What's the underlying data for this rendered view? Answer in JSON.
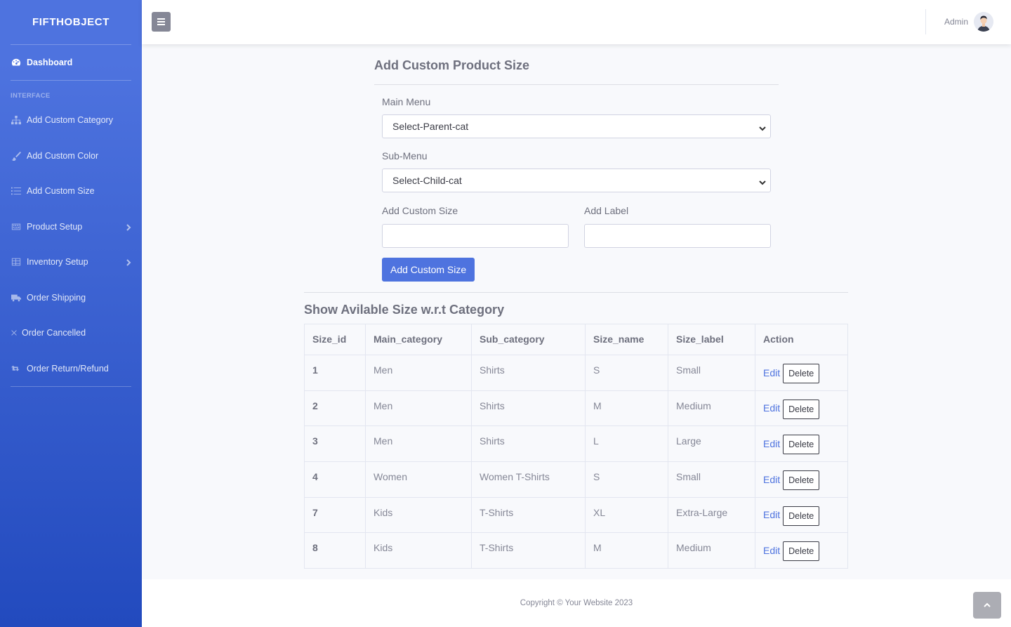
{
  "brand": "FIFTHOBJECT",
  "sidebar": {
    "dashboard": {
      "label": "Dashboard",
      "icon": "tachometer-icon"
    },
    "heading": "INTERFACE",
    "items": [
      {
        "label": "Add Custom Category",
        "icon": "sitemap-icon"
      },
      {
        "label": "Add Custom Color",
        "icon": "brush-icon"
      },
      {
        "label": "Add Custom Size",
        "icon": "list-icon"
      },
      {
        "label": "Product Setup",
        "icon": "keyboard-icon",
        "has_submenu": true
      },
      {
        "label": "Inventory Setup",
        "icon": "table-icon",
        "has_submenu": true
      },
      {
        "label": "Order Shipping",
        "icon": "truck-icon"
      },
      {
        "label": "Order Cancelled",
        "icon": "times-icon"
      },
      {
        "label": "Order Return/Refund",
        "icon": "retweet-icon"
      }
    ]
  },
  "topbar": {
    "user_name": "Admin"
  },
  "form": {
    "title": "Add Custom Product Size",
    "main_menu_label": "Main Menu",
    "main_menu_selected": "Select-Parent-cat",
    "sub_menu_label": "Sub-Menu",
    "sub_menu_selected": "Select-Child-cat",
    "custom_size_label": "Add Custom Size",
    "custom_size_value": "",
    "add_label_label": "Add Label",
    "add_label_value": "",
    "submit_label": "Add Custom Size"
  },
  "table": {
    "title": "Show Avilable Size w.r.t Category",
    "headers": [
      "Size_id",
      "Main_category",
      "Sub_category",
      "Size_name",
      "Size_label",
      "Action"
    ],
    "edit_label": "Edit",
    "delete_label": "Delete",
    "rows": [
      [
        "1",
        "Men",
        "Shirts",
        "S",
        "Small"
      ],
      [
        "2",
        "Men",
        "Shirts",
        "M",
        "Medium"
      ],
      [
        "3",
        "Men",
        "Shirts",
        "L",
        "Large"
      ],
      [
        "4",
        "Women",
        "Women T-Shirts",
        "S",
        "Small"
      ],
      [
        "7",
        "Kids",
        "T-Shirts",
        "XL",
        "Extra-Large"
      ],
      [
        "8",
        "Kids",
        "T-Shirts",
        "M",
        "Medium"
      ]
    ]
  },
  "footer": {
    "copyright": "Copyright © Your Website 2023"
  },
  "colors": {
    "sidebar_start": "#4e73df",
    "sidebar_end": "#224abe",
    "primary": "#4e73df"
  }
}
